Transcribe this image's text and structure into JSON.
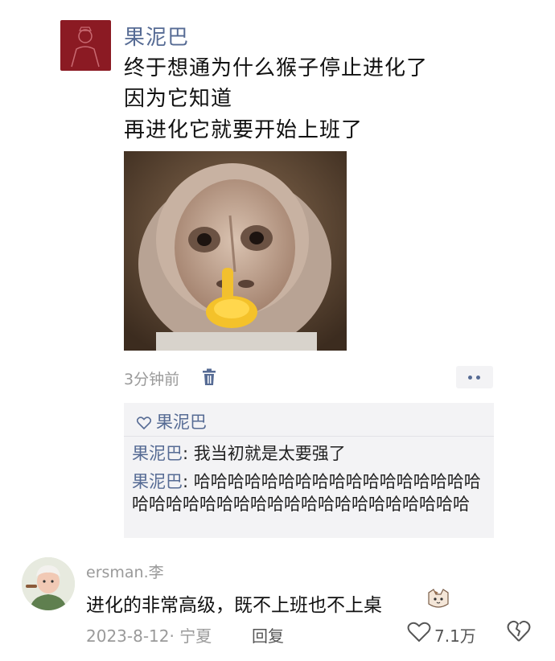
{
  "post": {
    "author": "果泥巴",
    "lines": [
      "终于想通为什么猴子停止进化了",
      "因为它知道",
      "再进化它就要开始上班了"
    ],
    "time": "3分钟前",
    "accent": "#566b94"
  },
  "comments_box": {
    "likes": "果泥巴",
    "items": [
      {
        "name": "果泥巴",
        "text": ": 我当初就是太要强了"
      },
      {
        "name": "果泥巴",
        "text": ": 哈哈哈哈哈哈哈哈哈哈哈哈哈哈哈哈哈哈哈哈哈哈哈哈哈哈哈哈哈哈哈哈哈哈哈哈哈"
      }
    ]
  },
  "reply": {
    "author": "ersman.李",
    "text": "进化的非常高级，既不上班也不上桌",
    "date": "2023-8-12· 宁夏",
    "reply_label": "回复",
    "like_count": "7.1万"
  },
  "icons": {
    "trash": "trash-icon",
    "more": "more-dots-icon",
    "heart": "heart-outline-icon",
    "dislike": "broken-heart-icon",
    "emoji": "cat-emoji-icon"
  }
}
